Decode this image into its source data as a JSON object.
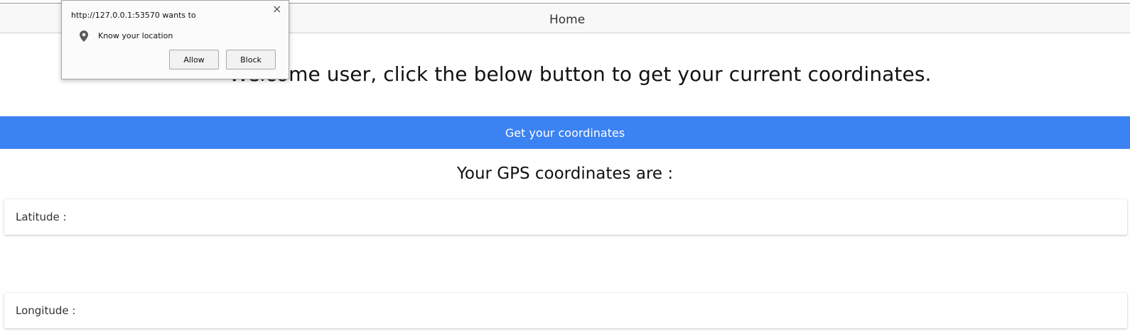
{
  "navbar": {
    "home_label": "Home"
  },
  "main": {
    "welcome_text": "Welcome user, click the below button to get your current coordinates.",
    "get_coordinates_label": "Get your coordinates",
    "gps_title": "Your GPS coordinates are :",
    "latitude_label": "Latitude :",
    "longitude_label": "Longitude :"
  },
  "permission_popup": {
    "origin_text": "http://127.0.0.1:53570 wants to",
    "permission_text": "Know your location",
    "close_glyph": "×",
    "allow_label": "Allow",
    "block_label": "Block",
    "icon": "location-pin-icon"
  },
  "colors": {
    "button_blue": "#3b82f3",
    "navbar_bg": "#f8f8f8",
    "popup_bg": "#fbfbfb"
  }
}
